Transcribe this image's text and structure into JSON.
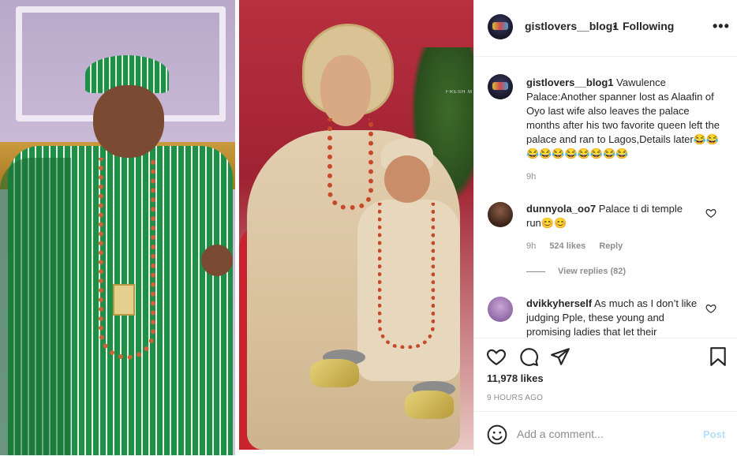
{
  "post": {
    "username": "gistlovers__blog1",
    "dot": "•",
    "follow_status": "Following",
    "more_glyph": "•••",
    "photo_watermark": "FRESH M",
    "caption": {
      "username": "gistlovers__blog1",
      "text": "Vawulence Palace:Another spanner lost as Alaafin of Oyo last wife also leaves the palace months after his two favorite queen left the palace and ran to Lagos,Details later😂😂😂😂😂😂😂😂😂😂",
      "time": "9h"
    },
    "comments": [
      {
        "username": "dunnyola_oo7",
        "text": "Palace ti di temple run😊😊",
        "time": "9h",
        "likes": "524 likes",
        "reply": "Reply",
        "view_replies": "View replies (82)"
      },
      {
        "username": "dvikkyherself",
        "text": "As much as I don’t like judging Pple, these young and promising ladies that let their"
      }
    ],
    "likes": "11,978 likes",
    "posted": "9 HOURS AGO",
    "add_comment_placeholder": "Add a comment...",
    "post_button": "Post"
  },
  "colors": {
    "text": "#262626",
    "muted": "#8e8e8e",
    "border": "#efefef",
    "post_disabled": "#b2dffc"
  },
  "icons": [
    "more-icon",
    "heart-icon",
    "comment-icon",
    "share-icon",
    "bookmark-icon",
    "emoji-icon"
  ]
}
